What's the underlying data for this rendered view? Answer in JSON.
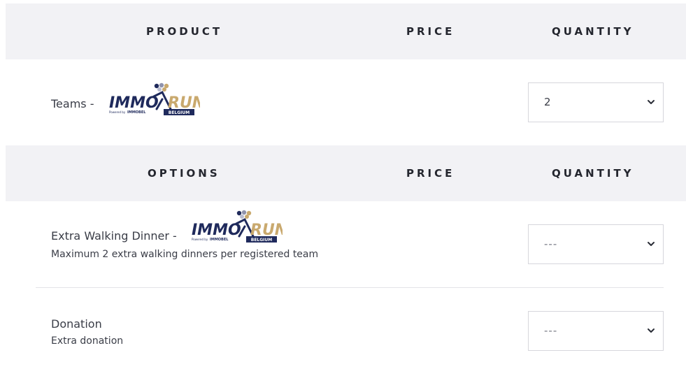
{
  "colors": {
    "header_bg": "#f2f2f5",
    "logo_navy": "#1f2a5c",
    "logo_gold": "#c9a96e",
    "text": "#3a3d47"
  },
  "product_header": {
    "product": "PRODUCT",
    "price": "PRICE",
    "quantity": "QUANTITY"
  },
  "product_row": {
    "label": "Teams -",
    "logo": {
      "text_a": "IMMO",
      "text_b": "RUN",
      "powered": "Powered by",
      "brand": "IMMOBEL",
      "sub": "BELGIUM"
    },
    "quantity": "2"
  },
  "options_header": {
    "options": "OPTIONS",
    "price": "PRICE",
    "quantity": "QUANTITY"
  },
  "options": [
    {
      "label": "Extra Walking Dinner -",
      "description": "Maximum 2 extra walking dinners per registered team",
      "quantity": "---"
    },
    {
      "label": "Donation",
      "description": "Extra donation",
      "quantity": "---"
    }
  ]
}
